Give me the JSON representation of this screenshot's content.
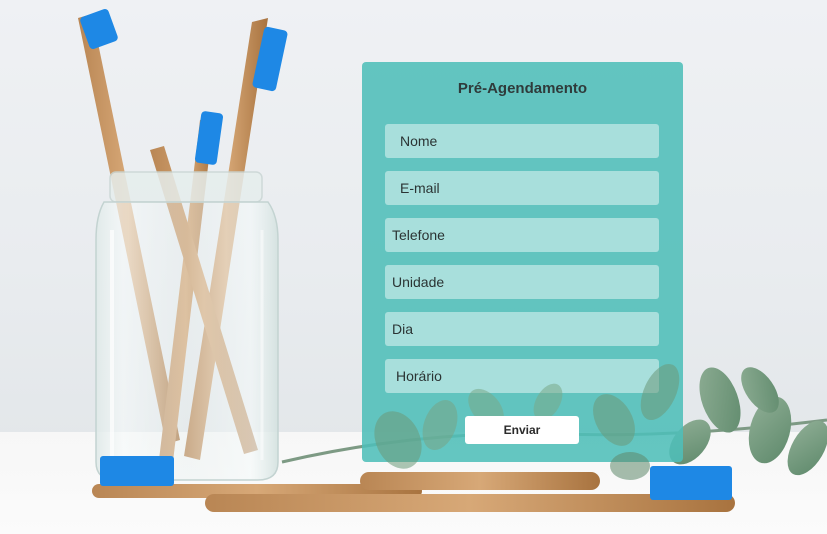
{
  "form": {
    "title": "Pré-Agendamento",
    "fields": [
      {
        "name": "name",
        "placeholder": "Nome"
      },
      {
        "name": "email",
        "placeholder": "E-mail"
      },
      {
        "name": "phone",
        "placeholder": "Telefone"
      },
      {
        "name": "unit",
        "placeholder": "Unidade"
      },
      {
        "name": "day",
        "placeholder": "Dia"
      },
      {
        "name": "time",
        "placeholder": "Horário"
      }
    ],
    "submit_label": "Enviar"
  },
  "background": {
    "brush_bristle_color": "#1e88e5",
    "accent": "#4ebeb8"
  }
}
